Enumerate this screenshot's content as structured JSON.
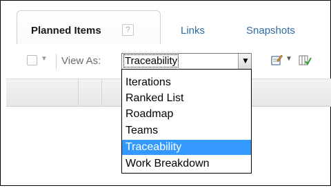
{
  "tabs": {
    "planned_items": "Planned Items",
    "help_glyph": "?",
    "links": "Links",
    "snapshots": "Snapshots"
  },
  "toolbar": {
    "view_as_label": "View As:",
    "selected_view": "Traceability"
  },
  "dropdown": {
    "options": [
      "Iterations",
      "Ranked List",
      "Roadmap",
      "Teams",
      "Traceability",
      "Work Breakdown"
    ],
    "selected_index": 4
  },
  "colors": {
    "selection": "#3399ff",
    "link": "#2d6ca2"
  },
  "icons": {
    "select_arrow": "chevron-down-icon",
    "edit": "edit-icon",
    "columns": "columns-icon"
  }
}
